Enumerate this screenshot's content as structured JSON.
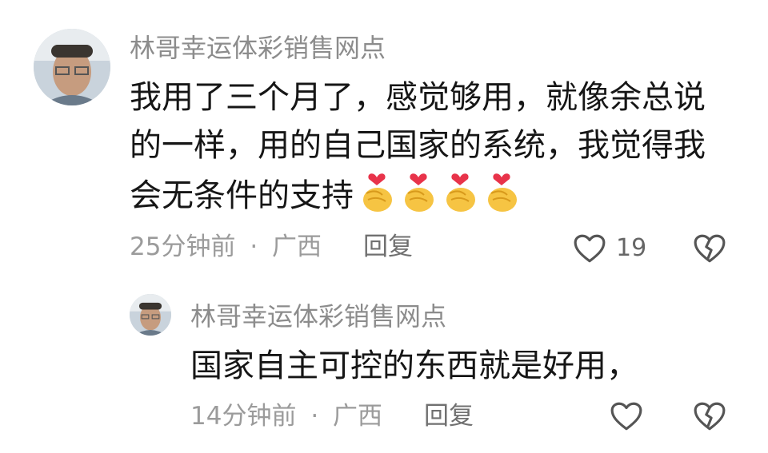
{
  "comment1": {
    "username": "林哥幸运体彩销售网点",
    "lines": [
      "我用了三个月了，感觉够用，就像余总说",
      "的一样，用的自己国家的系统，我觉得我",
      "会无条件的支持"
    ],
    "emojis": [
      "finger-heart-emoji",
      "finger-heart-emoji",
      "finger-heart-emoji",
      "finger-heart-emoji"
    ],
    "time": "25分钟前",
    "separator": "·",
    "location": "广西",
    "reply_label": "回复",
    "like_count": "19"
  },
  "comment2": {
    "username": "林哥幸运体彩销售网点",
    "text": "国家自主可控的东西就是好用，",
    "time": "14分钟前",
    "separator": "·",
    "location": "广西",
    "reply_label": "回复"
  },
  "icons": {
    "like": "heart-outline-icon",
    "dislike": "broken-heart-icon"
  }
}
